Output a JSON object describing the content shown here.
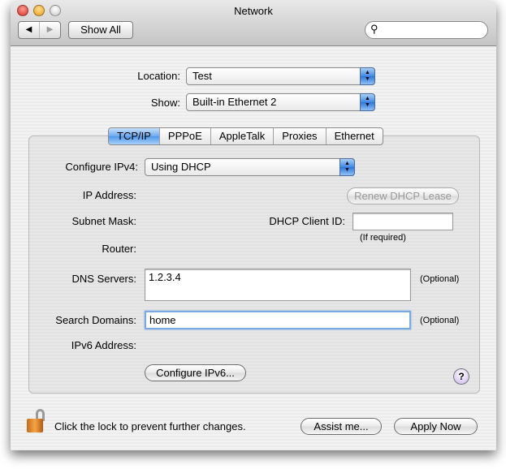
{
  "window": {
    "title": "Network",
    "traffic_lights": {
      "close": "#e0423a",
      "minimize": "#f0a827",
      "zoom": "#d0d0d0"
    }
  },
  "toolbar": {
    "back_icon": "back-arrow-icon",
    "forward_icon": "forward-arrow-icon",
    "show_all": "Show All",
    "search_placeholder": "",
    "search_icon": "magnifier-icon"
  },
  "location": {
    "label": "Location:",
    "value": "Test"
  },
  "show": {
    "label": "Show:",
    "value": "Built-in Ethernet 2"
  },
  "tabs": [
    {
      "label": "TCP/IP",
      "selected": true
    },
    {
      "label": "PPPoE"
    },
    {
      "label": "AppleTalk"
    },
    {
      "label": "Proxies"
    },
    {
      "label": "Ethernet"
    }
  ],
  "tcpip": {
    "configure_ipv4_label": "Configure IPv4:",
    "configure_ipv4_value": "Using DHCP",
    "ip_address_label": "IP Address:",
    "renew_button": "Renew DHCP Lease",
    "subnet_mask_label": "Subnet Mask:",
    "dhcp_client_id_label": "DHCP Client ID:",
    "dhcp_client_id_value": "",
    "if_required": "(If required)",
    "router_label": "Router:",
    "dns_label": "DNS Servers:",
    "dns_value": "1.2.3.4",
    "dns_optional": "(Optional)",
    "search_domains_label": "Search Domains:",
    "search_domains_value": "home",
    "search_optional": "(Optional)",
    "ipv6_label": "IPv6 Address:",
    "configure_ipv6_button": "Configure IPv6...",
    "help": "?"
  },
  "footer": {
    "lock_text": "Click the lock to prevent further changes.",
    "assist": "Assist me...",
    "apply": "Apply Now",
    "lock_icon": "unlocked-padlock-icon"
  }
}
